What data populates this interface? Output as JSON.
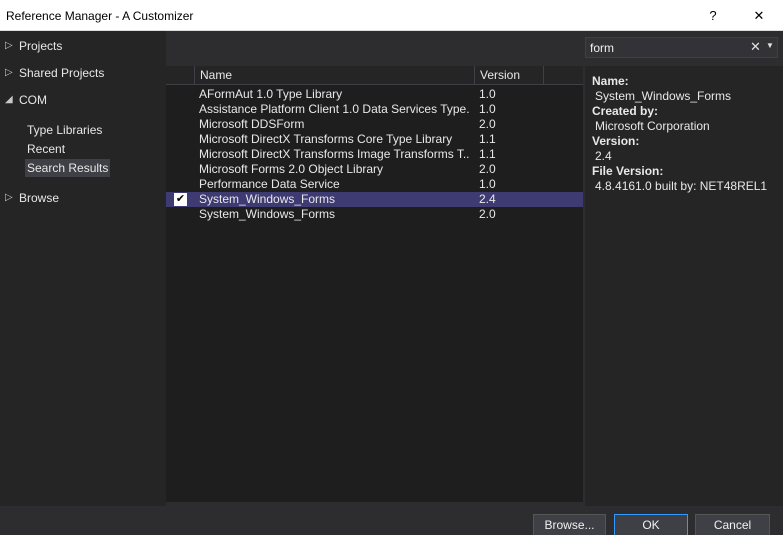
{
  "window": {
    "title": "Reference Manager - A Customizer",
    "help_label": "?",
    "close_label": "✕"
  },
  "tree": {
    "projects": "Projects",
    "shared_projects": "Shared Projects",
    "com": "COM",
    "com_children": [
      "Type Libraries",
      "Recent",
      "Search Results"
    ],
    "browse": "Browse"
  },
  "search": {
    "value": "form",
    "clear_label": "✕",
    "dropdown_label": "▼"
  },
  "table": {
    "headers": {
      "name": "Name",
      "version": "Version"
    },
    "rows": [
      {
        "name": "AFormAut 1.0 Type Library",
        "version": "1.0",
        "checked": false,
        "selected": false
      },
      {
        "name": "Assistance Platform Client 1.0 Data Services Type...",
        "version": "1.0",
        "checked": false,
        "selected": false
      },
      {
        "name": "Microsoft DDSForm",
        "version": "2.0",
        "checked": false,
        "selected": false
      },
      {
        "name": "Microsoft DirectX Transforms Core Type Library",
        "version": "1.1",
        "checked": false,
        "selected": false
      },
      {
        "name": "Microsoft DirectX Transforms Image Transforms T...",
        "version": "1.1",
        "checked": false,
        "selected": false
      },
      {
        "name": "Microsoft Forms 2.0 Object Library",
        "version": "2.0",
        "checked": false,
        "selected": false
      },
      {
        "name": "Performance Data Service",
        "version": "1.0",
        "checked": false,
        "selected": false
      },
      {
        "name": "System_Windows_Forms",
        "version": "2.4",
        "checked": true,
        "selected": true
      },
      {
        "name": "System_Windows_Forms",
        "version": "2.0",
        "checked": false,
        "selected": false
      }
    ]
  },
  "details": {
    "name_label": "Name:",
    "name_value": "System_Windows_Forms",
    "created_by_label": "Created by:",
    "created_by_value": "Microsoft Corporation",
    "version_label": "Version:",
    "version_value": "2.4",
    "file_version_label": "File Version:",
    "file_version_value": "4.8.4161.0 built by: NET48REL1"
  },
  "buttons": {
    "browse": "Browse...",
    "ok": "OK",
    "cancel": "Cancel"
  }
}
